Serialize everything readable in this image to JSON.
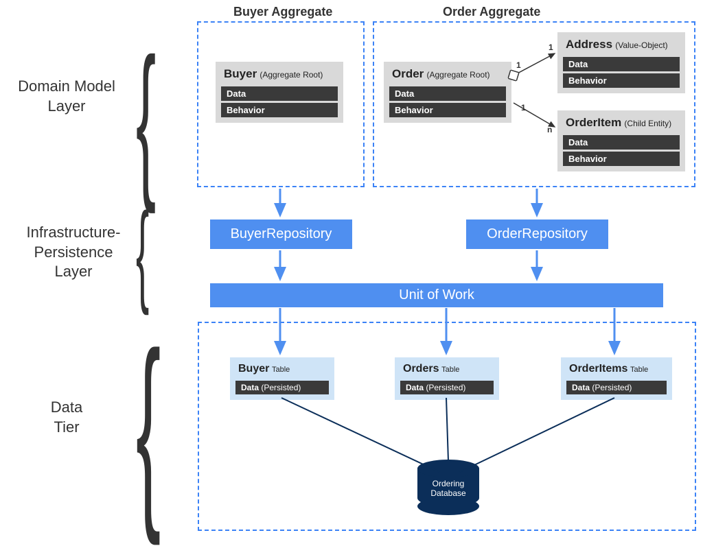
{
  "layers": {
    "domain": "Domain Model\nLayer",
    "infra": "Infrastructure-\nPersistence\nLayer",
    "data": "Data\nTier"
  },
  "aggregates": {
    "buyer_title": "Buyer Aggregate",
    "order_title": "Order Aggregate"
  },
  "entities": {
    "buyer": {
      "name": "Buyer",
      "stereo": "(Aggregate Root)",
      "row1": "Data",
      "row2": "Behavior"
    },
    "order": {
      "name": "Order",
      "stereo": "(Aggregate Root)",
      "row1": "Data",
      "row2": "Behavior"
    },
    "address": {
      "name": "Address",
      "stereo": "(Value-Object)",
      "row1": "Data",
      "row2": "Behavior"
    },
    "orderitem": {
      "name": "OrderItem",
      "stereo": "(Child Entity)",
      "row1": "Data",
      "row2": "Behavior"
    }
  },
  "repos": {
    "buyer": "BuyerRepository",
    "order": "OrderRepository",
    "uow": "Unit of Work"
  },
  "tables": {
    "buyer": {
      "name": "Buyer",
      "suffix": "Table",
      "row": "Data",
      "rowp": "(Persisted)"
    },
    "orders": {
      "name": "Orders",
      "suffix": "Table",
      "row": "Data",
      "rowp": "(Persisted)"
    },
    "orderitems": {
      "name": "OrderItems",
      "suffix": "Table",
      "row": "Data",
      "rowp": "(Persisted)"
    }
  },
  "db": {
    "label": "Ordering\nDatabase"
  },
  "cardinality": {
    "one_a": "1",
    "one_b": "1",
    "one_c": "1",
    "n": "n"
  }
}
